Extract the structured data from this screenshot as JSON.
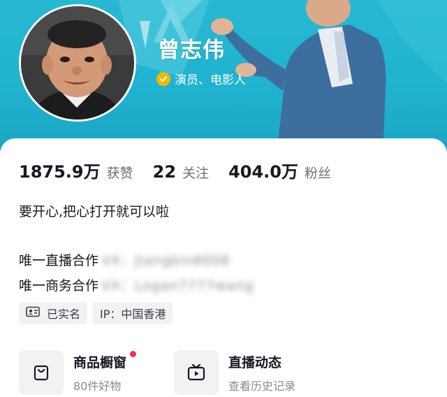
{
  "profile": {
    "name": "曾志伟",
    "verify_text": "演员、电影人"
  },
  "stats": [
    {
      "value": "1875.9万",
      "label": "获赞"
    },
    {
      "value": "22",
      "label": "关注"
    },
    {
      "value": "404.0万",
      "label": "粉丝"
    }
  ],
  "bio": "要开心,把心打开就可以啦",
  "contacts": [
    {
      "prefix": "唯一直播合作",
      "value": "VX：Jiangbin8008"
    },
    {
      "prefix": "唯一商务合作",
      "value": "VX：Logan7777wang"
    }
  ],
  "tags": [
    {
      "label": "已实名",
      "icon": "id-card-icon"
    },
    {
      "label": "IP：中国香港"
    }
  ],
  "entries": [
    {
      "title": "商品橱窗",
      "subtitle": "80件好物",
      "icon": "shopping-bag-icon",
      "has_dot": true
    },
    {
      "title": "直播动态",
      "subtitle": "查看历史记录",
      "icon": "tv-play-icon",
      "has_dot": false
    }
  ],
  "colors": {
    "banner": "#1fb3cf",
    "verify_badge": "#f5b800",
    "notification_dot": "#fe2c55"
  }
}
